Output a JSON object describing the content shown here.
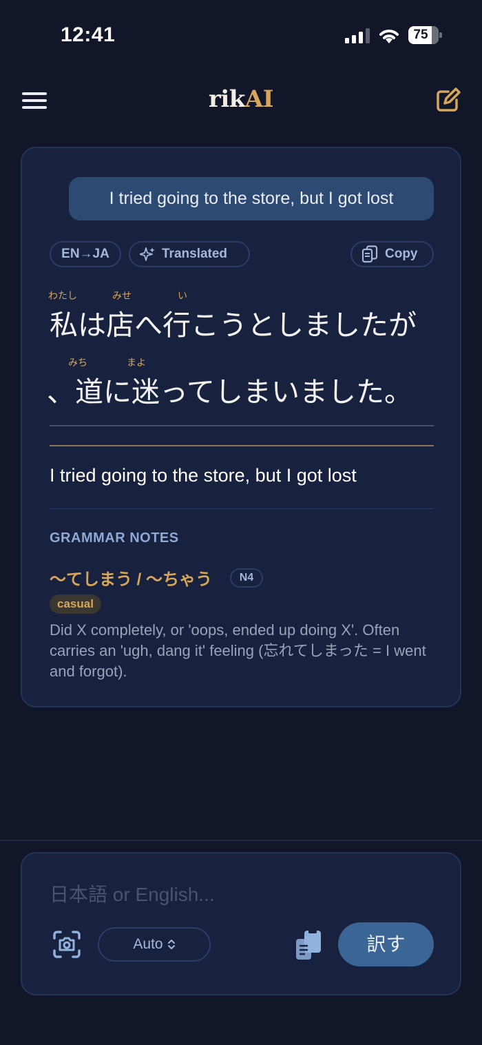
{
  "status_bar": {
    "time": "12:41",
    "battery": "75"
  },
  "header": {
    "logo_part1": "rik",
    "logo_part2": "AI",
    "menu_icon": "hamburger-menu-icon",
    "compose_icon": "compose-edit-icon"
  },
  "conversation": {
    "user_message": "I tried going to the store, but I got lost",
    "chips": {
      "direction": "EN→JA",
      "status": "Translated",
      "copy": "Copy"
    },
    "japanese": {
      "line1": "私は店へ行こうとしましたが",
      "line2": "、道に迷ってしまいました。",
      "furigana": {
        "watashi": "わたし",
        "mise": "みせ",
        "i": "い",
        "michi": "みち",
        "mayo": "まよ"
      }
    },
    "english": "I tried going to the store, but I got lost",
    "grammar": {
      "heading": "GRAMMAR NOTES",
      "title": "〜てしまう / 〜ちゃう",
      "level": "N4",
      "register": "casual",
      "description": "Did X completely, or 'oops, ended up doing X'. Often carries an 'ugh, dang it' feeling (忘れてしまった = I went and forgot)."
    }
  },
  "input": {
    "placeholder": "日本語 or English...",
    "mode": "Auto",
    "translate_label": "訳す"
  },
  "colors": {
    "background": "#111729",
    "card": "#18213d",
    "accent_gold": "#d6a75b",
    "accent_blue": "#3a6595"
  }
}
